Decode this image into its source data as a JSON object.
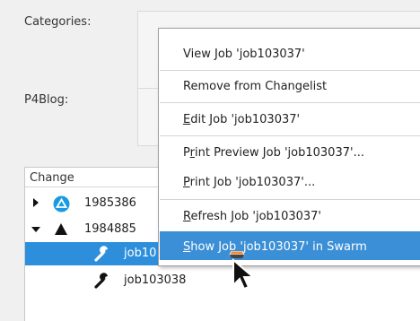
{
  "form": {
    "categories_label": "Categories:",
    "p4blog_label": "P4Blog:"
  },
  "tree": {
    "header": "Change",
    "rows": [
      {
        "label": "1985386",
        "icon": "blue-triangle-icon"
      },
      {
        "label": "1984885",
        "icon": "black-triangle-icon"
      },
      {
        "label": "job10",
        "icon": "wrench-icon"
      },
      {
        "label": "job103038",
        "icon": "wrench-icon"
      }
    ]
  },
  "menu": {
    "items": [
      {
        "pre": "",
        "ul": "",
        "post": "View Job 'job103037'"
      },
      {
        "pre": "",
        "ul": "",
        "post": "Remove from Changelist"
      },
      {
        "pre": "",
        "ul": "E",
        "post": "dit Job 'job103037'"
      },
      {
        "pre": "P",
        "ul": "r",
        "post": "int Preview Job 'job103037'..."
      },
      {
        "pre": "",
        "ul": "P",
        "post": "rint Job 'job103037'..."
      },
      {
        "pre": "",
        "ul": "R",
        "post": "efresh Job 'job103037'"
      },
      {
        "pre": "",
        "ul": "S",
        "post": "how Job 'job103037' in Swarm"
      }
    ]
  },
  "colors": {
    "selection": "#2d8fdc",
    "menu_highlight": "#3b8fd6",
    "swarm_orange": "#f08a3c"
  }
}
